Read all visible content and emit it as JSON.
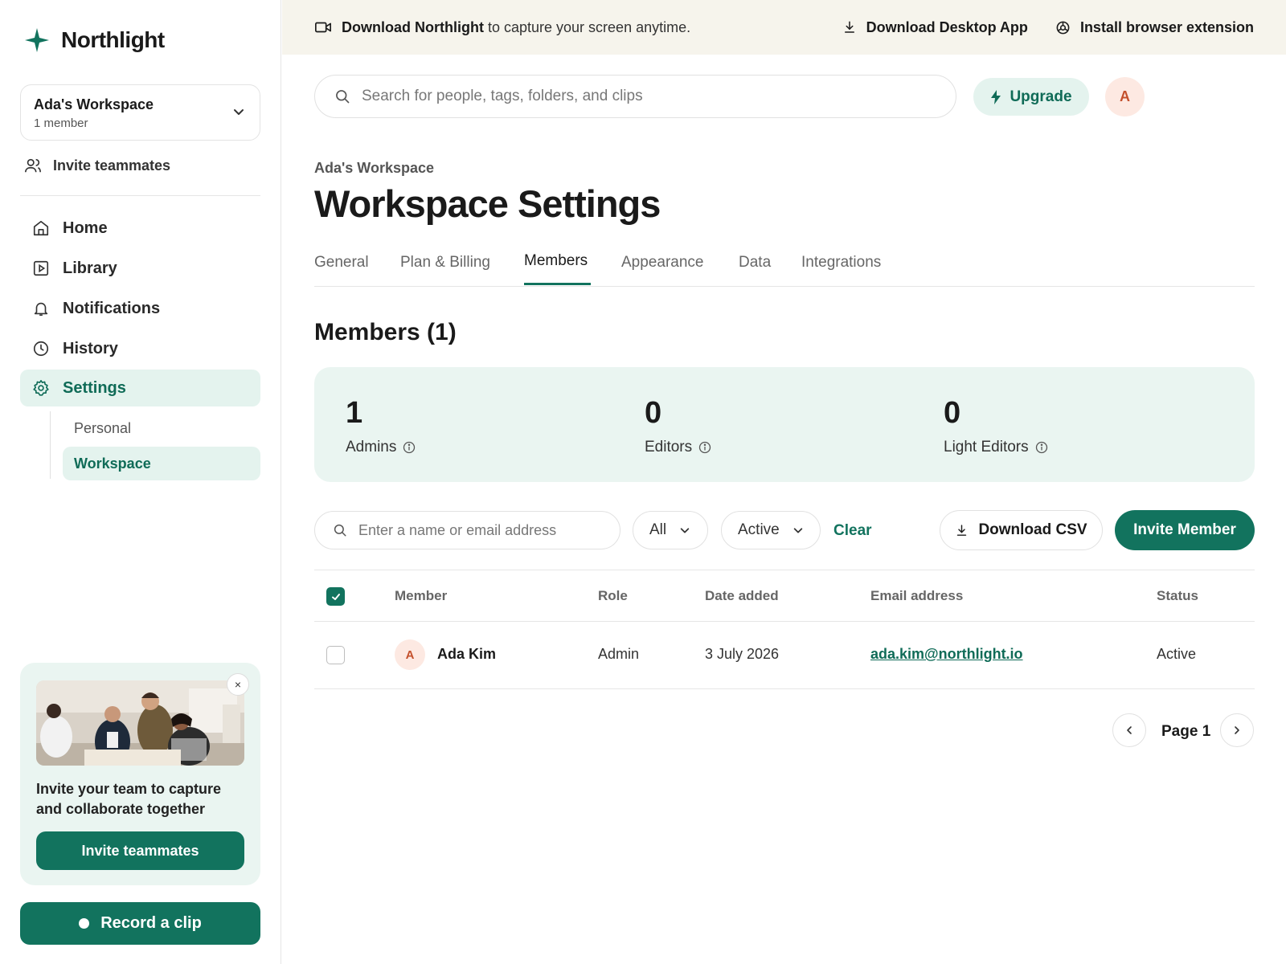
{
  "brand": {
    "name": "Northlight",
    "accent": "#12735e"
  },
  "sidebar": {
    "workspace_name": "Ada's Workspace",
    "workspace_members": "1 member",
    "invite_label": "Invite teammates",
    "nav": [
      {
        "label": "Home",
        "icon": "home-icon"
      },
      {
        "label": "Library",
        "icon": "play-square-icon"
      },
      {
        "label": "Notifications",
        "icon": "bell-icon"
      },
      {
        "label": "History",
        "icon": "clock-icon"
      },
      {
        "label": "Settings",
        "icon": "gear-icon",
        "active": true
      }
    ],
    "settings_sub": [
      {
        "label": "Personal"
      },
      {
        "label": "Workspace",
        "active": true
      }
    ],
    "promo": {
      "text": "Invite your team to capture and collaborate together",
      "button": "Invite teammates",
      "close": "×"
    },
    "record_button": "Record a clip"
  },
  "banner": {
    "bold": "Download Northlight",
    "rest": "to capture your screen anytime.",
    "download_app": "Download Desktop App",
    "install_ext": "Install browser extension"
  },
  "topbar": {
    "search_placeholder": "Search for people, tags, folders, and clips",
    "upgrade": "Upgrade",
    "avatar_initial": "A"
  },
  "page": {
    "breadcrumb": "Ada's Workspace",
    "title": "Workspace Settings",
    "tabs": [
      {
        "label": "General"
      },
      {
        "label": "Plan & Billing"
      },
      {
        "label": "Members",
        "active": true
      },
      {
        "label": "Appearance"
      },
      {
        "label": "Data"
      },
      {
        "label": "Integrations"
      }
    ]
  },
  "members": {
    "title": "Members (1)",
    "stats": [
      {
        "value": "1",
        "label": "Admins"
      },
      {
        "value": "0",
        "label": "Editors"
      },
      {
        "value": "0",
        "label": "Light Editors"
      }
    ],
    "filter_placeholder": "Enter a name or email address",
    "role_filter": "All",
    "status_filter": "Active",
    "clear": "Clear",
    "download_csv": "Download CSV",
    "invite_member": "Invite Member",
    "columns": [
      "Member",
      "Role",
      "Date added",
      "Email address",
      "Status"
    ],
    "rows": [
      {
        "initial": "A",
        "name": "Ada Kim",
        "role": "Admin",
        "date_added": "3 July 2026",
        "email": "ada.kim@northlight.io",
        "status": "Active",
        "selected": false
      }
    ],
    "header_checkbox_checked": true,
    "page_label": "Page 1"
  }
}
